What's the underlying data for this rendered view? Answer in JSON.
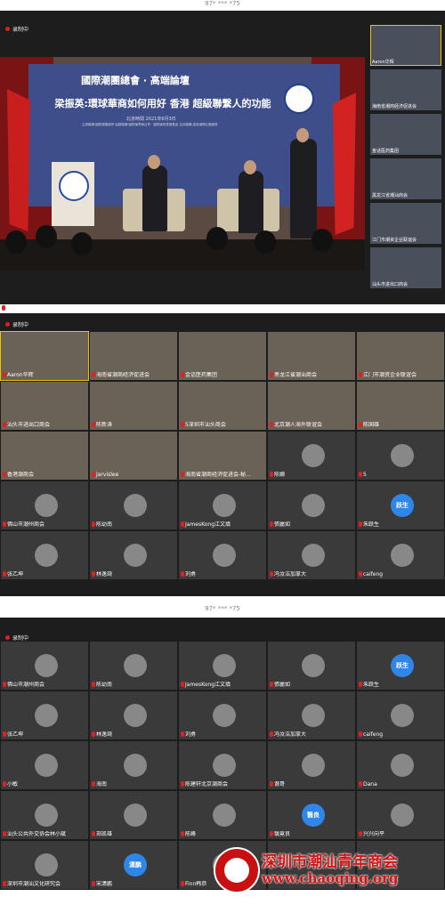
{
  "captions": {
    "top": "97* *** *75",
    "middle": "97* *** *75"
  },
  "recording": "录制中",
  "speaker_view": {
    "banner_title": "國際潮團總會 · 高端論壇",
    "banner_subtitle": "梁振英:環球華商如何用好 香港 超級聯繫人的功能",
    "banner_date": "北京時間 2021年6月3日",
    "banner_small": "主辦機構:國際潮團總會  協辦機構:國際潮青聯合會 · 國際潮商發展基金  支持機構:香港潮屬社團總會",
    "active_speaker": "Aaron华辉",
    "side_tiles": [
      {
        "label": "Aaron华辉"
      },
      {
        "label": "海南省潮商经济促进会"
      },
      {
        "label": "金话医药集团"
      },
      {
        "label": "黑龙江省潮汕商会"
      },
      {
        "label": "江门市潮资企业联谊会"
      },
      {
        "label": "汕头市进出口商会"
      }
    ]
  },
  "grid_a": [
    {
      "label": "Aaron华辉"
    },
    {
      "label": "海南省潮商经济促进会"
    },
    {
      "label": "金话医药集团"
    },
    {
      "label": "黑龙江省潮汕商会"
    },
    {
      "label": "江门市潮资企业联谊会"
    },
    {
      "label": "汕头市进出口商会"
    },
    {
      "label": "陈新涛"
    },
    {
      "label": "5深圳市汕头商会"
    },
    {
      "label": "北京潮人海外联谊会"
    },
    {
      "label": "陈国雄"
    },
    {
      "label": "香港潮商会"
    },
    {
      "label": "Jarvislee"
    },
    {
      "label": "海南省潮商经济促进会-秘..."
    },
    {
      "label": "陈嫄"
    },
    {
      "label": "5"
    },
    {
      "label": "佛山市潮州商会"
    },
    {
      "label": "陈幼南"
    },
    {
      "label": "JamesKong江文填"
    },
    {
      "label": "張麗如"
    },
    {
      "label": "朱跃生",
      "initial": "跃生"
    },
    {
      "label": "张乙坤"
    },
    {
      "label": "林逸琦"
    },
    {
      "label": "刘勇"
    },
    {
      "label": "冯汝洁加拿大"
    },
    {
      "label": "caifeng"
    }
  ],
  "grid_b": [
    {
      "label": "佛山市潮州商会"
    },
    {
      "label": "陈幼南"
    },
    {
      "label": "JamesKong江文填"
    },
    {
      "label": "張麗如"
    },
    {
      "label": "朱跃生",
      "initial": "跃生"
    },
    {
      "label": "张乙坤"
    },
    {
      "label": "林逸琦"
    },
    {
      "label": "刘勇"
    },
    {
      "label": "冯汝洁加拿大"
    },
    {
      "label": "caifeng"
    },
    {
      "label": "小敏"
    },
    {
      "label": "海南"
    },
    {
      "label": "陈建轩北京潮商会"
    },
    {
      "label": "谯哥"
    },
    {
      "label": "Dana"
    },
    {
      "label": "汕头公共外交协会林小斌"
    },
    {
      "label": "郑凯雄"
    },
    {
      "label": "陈峰"
    },
    {
      "label": "翳竟良",
      "initial": "翳良"
    },
    {
      "label": "兴兴向平"
    },
    {
      "label": "深圳市潮汕文化研究会"
    },
    {
      "label": "宋潇鹏",
      "initial": "潇鹏"
    },
    {
      "label": "Finn韩恭"
    },
    {
      "label": ""
    },
    {
      "label": ""
    }
  ],
  "watermark": {
    "line1": "深圳市潮汕青年商会",
    "line2": "www.chaoqing.org"
  }
}
